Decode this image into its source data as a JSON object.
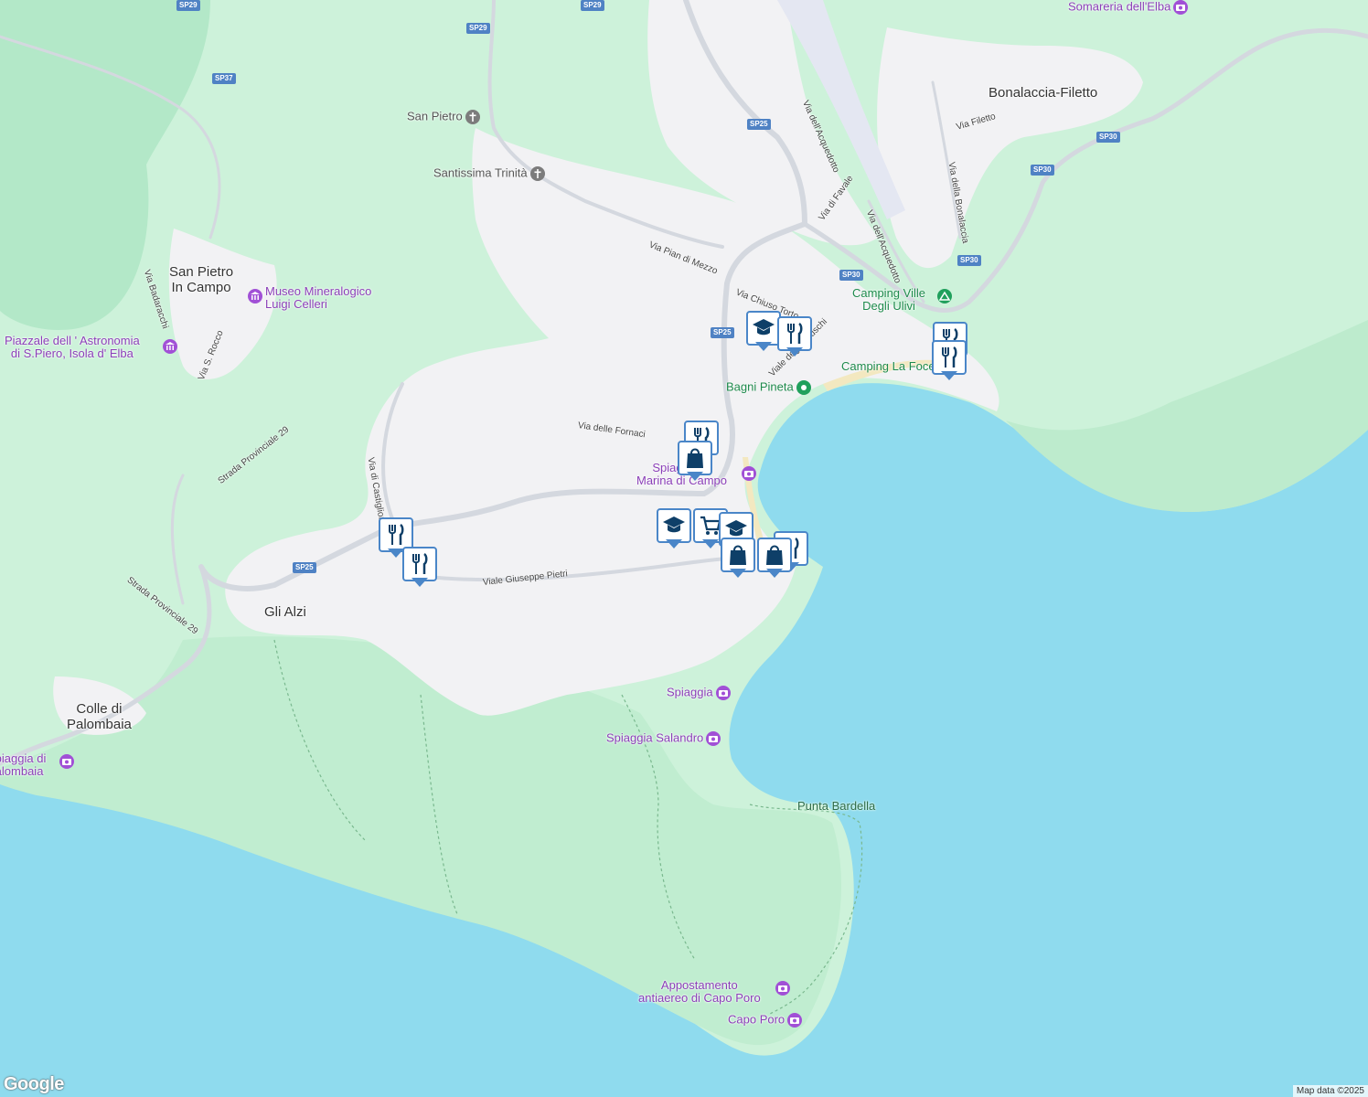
{
  "places": {
    "san_pietro_in_campo": "San Pietro\nIn Campo",
    "bonalaccia": "Bonalaccia-Filetto",
    "gli_alzi": "Gli Alzi",
    "colle": "Colle di\nPalombaia"
  },
  "pois": {
    "somareria": "Somareria dell'Elba",
    "museo": "Museo Mineralogico\nLuigi Celleri",
    "astronomia": "Piazzale dell ' Astronomia\ndi S.Piero, Isola d' Elba",
    "spiaggia_marina": "Spiaggia di\nMarina di Campo",
    "spiaggia": "Spiaggia",
    "salandro": "Spiaggia Salandro",
    "palombaia": "Spiaggia di\nPalombaia",
    "appostamento": "Appostamento\nantiaereo di Capo Poro",
    "capo_poro": "Capo Poro"
  },
  "green_pois": {
    "camping_ulivi": "Camping Ville\nDegli Ulivi",
    "camping_foce": "Camping La Foce",
    "bagni_pineta": "Bagni Pineta"
  },
  "religious": {
    "san_pietro": "San Pietro",
    "trinita": "Santissima Trinità"
  },
  "capes": {
    "punta_bardella": "Punta Bardella"
  },
  "streets": {
    "acquedotto1": "Via dell'Acquedotto",
    "acquedotto2": "Via dell'Acquedotto",
    "favale": "Via di Favale",
    "filetto": "Via Filetto",
    "bonalaccia": "Via della Bonalaccia",
    "pian_di_mezzo": "Via Pian di Mezzo",
    "chiuso_torto": "Via Chiuso Torto",
    "etruschi": "Viale degli Etruschi",
    "fornaci": "Via delle Fornaci",
    "castiglione": "Via di Castiglione",
    "pietri": "Viale Giuseppe Pietri",
    "sp29_label": "Strada Provinciale 29",
    "sp29_label2": "Strada Provinciale 29",
    "badaracchi": "Via Badaracchi",
    "s_rocco": "Via S. Rocco"
  },
  "shields": {
    "sp29a": "SP29",
    "sp29b": "SP29",
    "sp29c": "SP29",
    "sp37": "SP37",
    "sp25a": "SP25",
    "sp25b": "SP25",
    "sp25c": "SP25",
    "sp30a": "SP30",
    "sp30b": "SP30",
    "sp30c": "SP30",
    "sp30d": "SP30"
  },
  "markers": [
    {
      "icon": "graduation-cap-icon"
    },
    {
      "icon": "restaurant-icon"
    },
    {
      "icon": "restaurant-icon"
    },
    {
      "icon": "restaurant-icon"
    },
    {
      "icon": "restaurant-icon"
    },
    {
      "icon": "shopping-bag-icon"
    },
    {
      "icon": "graduation-cap-icon"
    },
    {
      "icon": "shopping-bag-icon"
    },
    {
      "icon": "shopping-bag-icon"
    },
    {
      "icon": "restaurant-icon"
    },
    {
      "icon": "restaurant-icon"
    },
    {
      "icon": "restaurant-icon"
    }
  ],
  "attribution": {
    "logo": "Google",
    "map_data": "Map data ©2025"
  },
  "colors": {
    "water": "#8fdbee",
    "land": "#c8f0d8",
    "urban": "#f2f2f4",
    "marker_border": "#4a86c8",
    "poi_purple": "#8b3fb8"
  }
}
